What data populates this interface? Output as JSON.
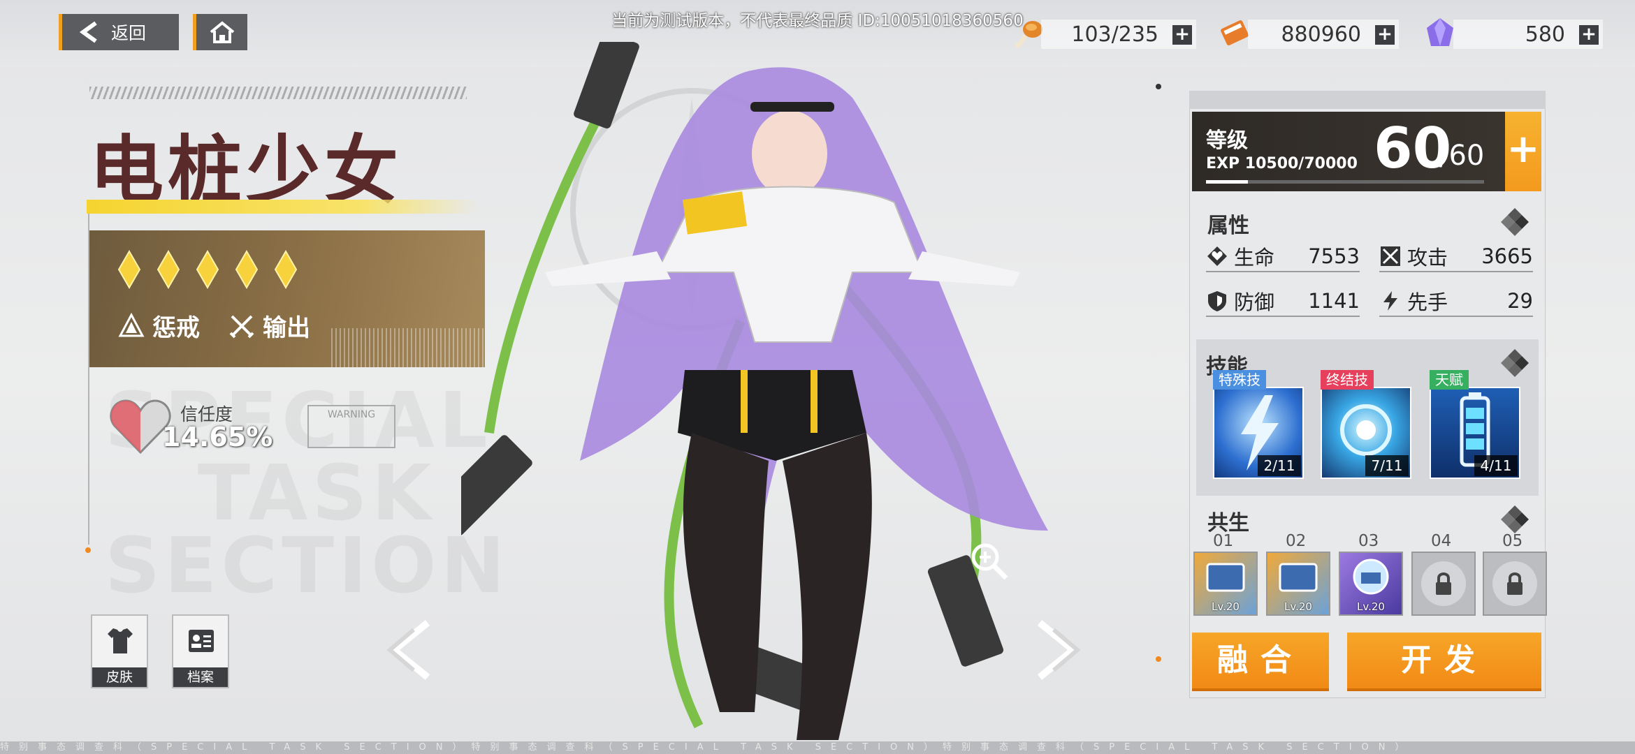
{
  "topbar": {
    "back_label": "返回",
    "test_notice": "当前为测试版本，不代表最终品质 ID:10051018360560",
    "resources": [
      {
        "name": "stamina",
        "icon": "drumstick-icon",
        "value": "103/235"
      },
      {
        "name": "gold",
        "icon": "book-icon",
        "value": "880960"
      },
      {
        "name": "gems",
        "icon": "crystal-icon",
        "value": "580"
      }
    ],
    "plus_label": "+"
  },
  "character": {
    "name": "电桩少女",
    "stars": 5,
    "roles": [
      {
        "icon": "discipline-icon",
        "label": "惩戒"
      },
      {
        "icon": "crossed-swords-icon",
        "label": "输出"
      }
    ],
    "trust_label": "信任度",
    "trust_value": "14.65%",
    "warning_text": "WARNING"
  },
  "side_buttons": {
    "skin_label": "皮肤",
    "profile_label": "档案"
  },
  "level": {
    "label": "等级",
    "exp_text": "EXP 10500/70000",
    "exp_fraction": 0.15,
    "current": "60",
    "max": "/60",
    "plus": "+"
  },
  "attributes": {
    "title": "属性",
    "stats": [
      {
        "icon": "hp-icon",
        "name": "生命",
        "value": "7553"
      },
      {
        "icon": "attack-icon",
        "name": "攻击",
        "value": "3665"
      },
      {
        "icon": "defense-icon",
        "name": "防御",
        "value": "1141"
      },
      {
        "icon": "speed-icon",
        "name": "先手",
        "value": "29"
      }
    ]
  },
  "skills": {
    "title": "技能",
    "items": [
      {
        "tag": "特殊技",
        "tag_color": "#4b8fe0",
        "count": "2/11",
        "icon": "lightning-skill-icon"
      },
      {
        "tag": "终结技",
        "tag_color": "#e6405c",
        "count": "7/11",
        "icon": "energy-orb-skill-icon"
      },
      {
        "tag": "天赋",
        "tag_color": "#36b060",
        "count": "4/11",
        "icon": "battery-skill-icon"
      }
    ]
  },
  "symbiosis": {
    "title": "共生",
    "slots": [
      {
        "num": "01",
        "level": "Lv.20",
        "locked": false
      },
      {
        "num": "02",
        "level": "Lv.20",
        "locked": false
      },
      {
        "num": "03",
        "level": "Lv.20",
        "locked": false
      },
      {
        "num": "04",
        "level": "",
        "locked": true
      },
      {
        "num": "05",
        "level": "",
        "locked": true
      }
    ]
  },
  "actions": {
    "fuse_label": "融合",
    "develop_label": "开发"
  },
  "footer_text": "特别事态调查科（SPECIAL TASK SECTION）特别事态调查科（SPECIAL TASK SECTION）特别事态调查科（SPECIAL TASK SECTION）"
}
